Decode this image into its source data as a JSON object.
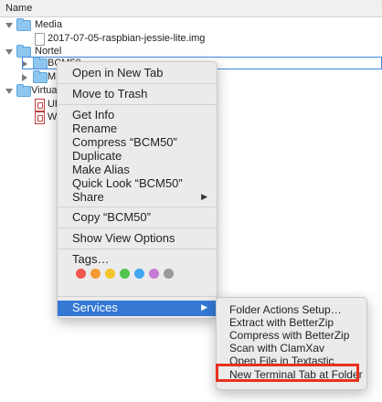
{
  "header": {
    "name_col": "Name"
  },
  "tree": [
    {
      "label": "Media",
      "type": "folder",
      "expanded": true
    },
    {
      "label": "2017-07-05-raspbian-jessie-lite.img",
      "type": "file"
    },
    {
      "label": "Nortel",
      "type": "folder",
      "expanded": true
    },
    {
      "label": "BCM50",
      "type": "folder",
      "expanded": false
    },
    {
      "label": "ME",
      "type": "folder",
      "expanded": false
    },
    {
      "label": "Virtua",
      "type": "folder",
      "expanded": true
    },
    {
      "label": "Ub",
      "type": "file"
    },
    {
      "label": "Wi",
      "type": "file"
    }
  ],
  "context_menu": {
    "items": [
      "Open in New Tab",
      "Move to Trash",
      "Get Info",
      "Rename",
      "Compress “BCM50”",
      "Duplicate",
      "Make Alias",
      "Quick Look “BCM50”",
      "Share",
      "Copy “BCM50”",
      "Show View Options",
      "Tags…",
      "Services"
    ],
    "tag_colors": [
      "#f0564e",
      "#f59a33",
      "#f3c52c",
      "#52c44e",
      "#3fa8f0",
      "#c57ad6",
      "#9a9a9a"
    ]
  },
  "services_submenu": {
    "items": [
      "Folder Actions Setup…",
      "Extract with BetterZip",
      "Compress with BetterZip",
      "Scan with ClamXav",
      "Open File in Textastic",
      "New Terminal Tab at Folder"
    ],
    "highlight_color": "#e8311e"
  },
  "colors": {
    "selection": "#3478d4",
    "folder": "#8fc6f0"
  }
}
